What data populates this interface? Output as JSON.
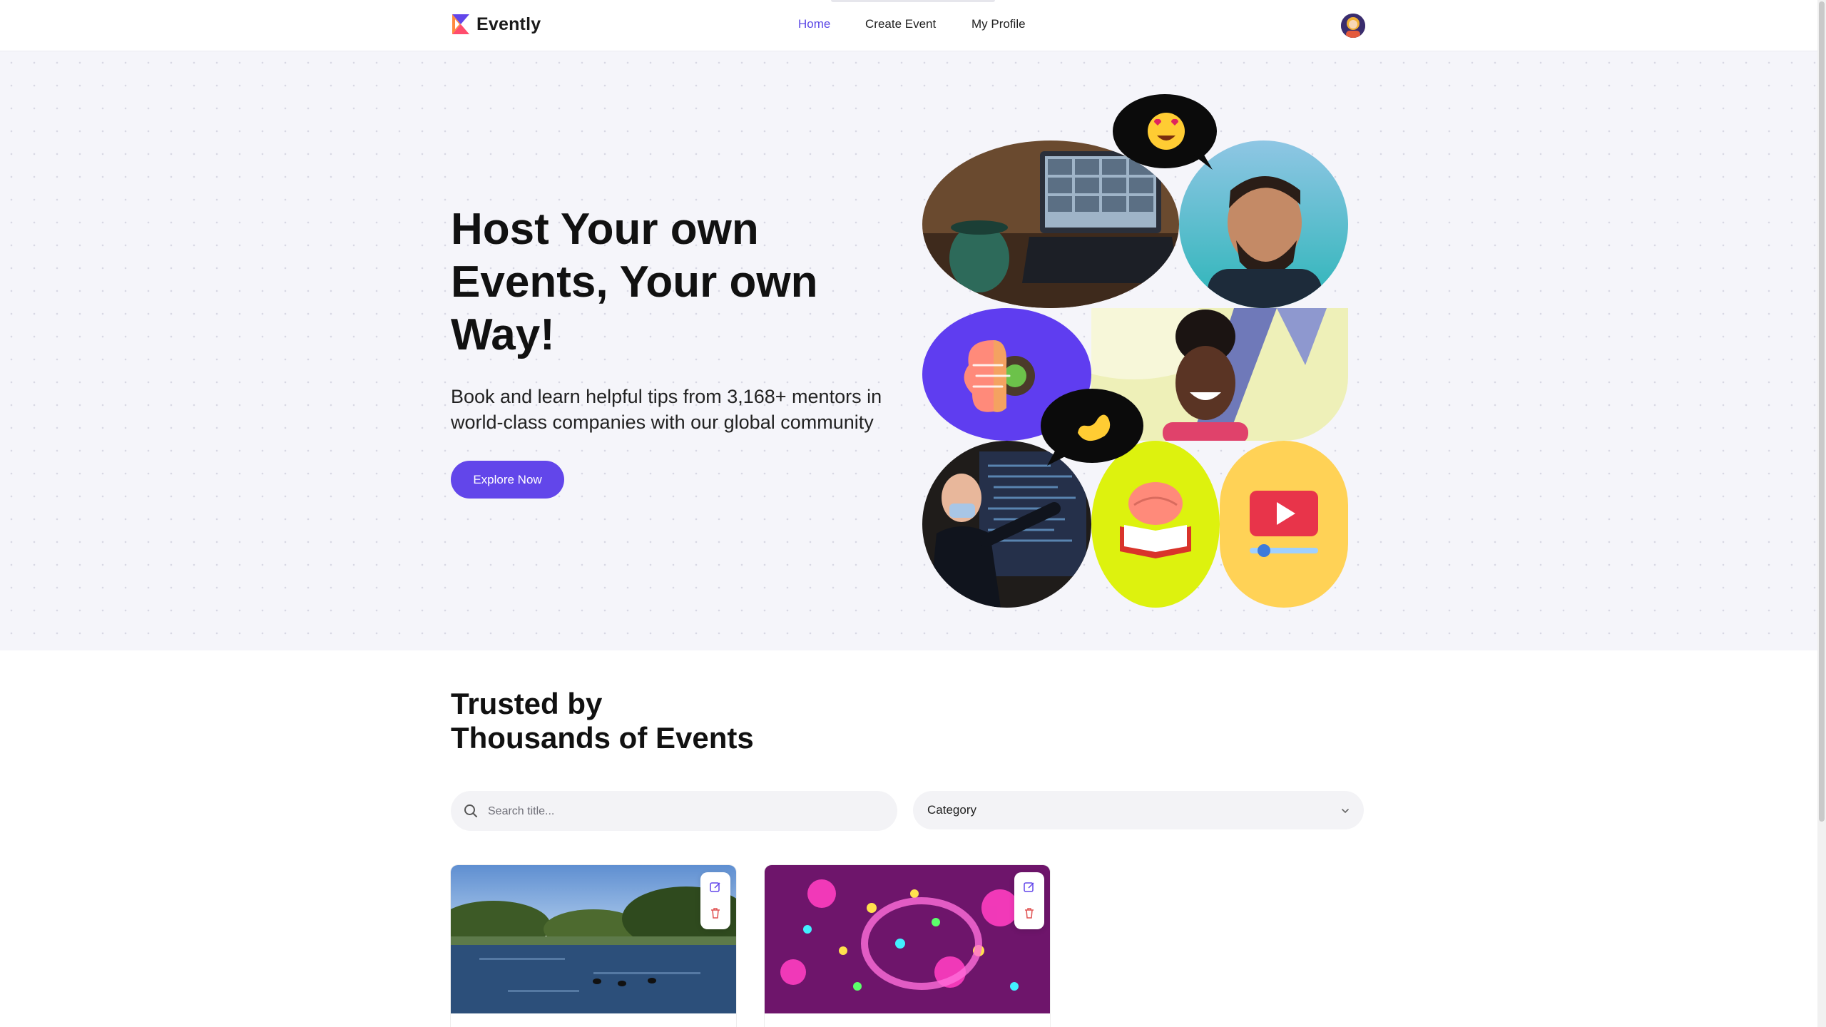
{
  "brand": {
    "name": "Evently",
    "accent": "#6246ea"
  },
  "nav": {
    "items": [
      {
        "label": "Home",
        "active": true
      },
      {
        "label": "Create Event",
        "active": false
      },
      {
        "label": "My Profile",
        "active": false
      }
    ]
  },
  "hero": {
    "title": "Host Your own Events, Your own Way!",
    "subtitle": "Book and learn helpful tips from 3,168+ mentors in world-class companies with our global community",
    "cta_label": "Explore Now"
  },
  "events_section": {
    "title_line1": "Trusted by",
    "title_line2": "Thousands of Events",
    "search_placeholder": "Search title...",
    "category_label": "Category"
  },
  "event_cards": [
    {
      "image": "lake-park-photo",
      "actions": [
        "edit-icon",
        "delete-icon"
      ]
    },
    {
      "image": "neon-party-photo",
      "actions": [
        "edit-icon",
        "delete-icon"
      ]
    }
  ]
}
